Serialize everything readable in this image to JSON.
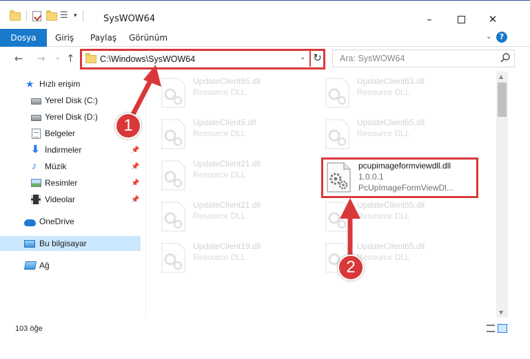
{
  "window": {
    "title": "SysWOW64",
    "icons": [
      "folder-icon",
      "properties-icon",
      "new-folder-icon"
    ],
    "controls": {
      "minimize": "–",
      "close": "✕"
    }
  },
  "ribbon": {
    "tabs": [
      {
        "label": "Dosya",
        "active": true
      },
      {
        "label": "Giriş",
        "active": false
      },
      {
        "label": "Paylaş",
        "active": false
      },
      {
        "label": "Görünüm",
        "active": false
      }
    ],
    "help": "?"
  },
  "navigation": {
    "back": "←",
    "forward": "→",
    "up": "↑",
    "address": "C:\\Windows\\SysWOW64",
    "refresh": "↻",
    "search_placeholder": "Ara: SysWOW64"
  },
  "sidebar": {
    "items": [
      {
        "label": "Hızlı erişim",
        "icon": "star-icon"
      },
      {
        "label": "Yerel Disk (C:)",
        "icon": "drive-icon"
      },
      {
        "label": "Yerel Disk (D:)",
        "icon": "drive-icon"
      },
      {
        "label": "Belgeler",
        "icon": "documents-icon"
      },
      {
        "label": "İndirmeler",
        "icon": "downloads-icon",
        "pinned": true
      },
      {
        "label": "Müzik",
        "icon": "music-icon",
        "pinned": true
      },
      {
        "label": "Resimler",
        "icon": "pictures-icon",
        "pinned": true
      },
      {
        "label": "Videolar",
        "icon": "videos-icon",
        "pinned": true
      },
      {
        "label": "OneDrive",
        "icon": "onedrive-icon"
      },
      {
        "label": "Bu bilgisayar",
        "icon": "this-pc-icon",
        "selected": true
      },
      {
        "label": "Ağ",
        "icon": "network-icon"
      }
    ],
    "pin_glyph": "📌"
  },
  "files": {
    "left_column": [
      {
        "name": "UpdateClient65.dll",
        "desc": "Resource DLL"
      },
      {
        "name": "UpdateClient5.dll",
        "desc": "Resource DLL"
      },
      {
        "name": "UpdateClient21.dll",
        "desc": "Resource DLL"
      },
      {
        "name": "UpdateClient21.dll",
        "desc": "Resource DLL"
      },
      {
        "name": "UpdateClient19.dll",
        "desc": "Resource DLL"
      }
    ],
    "right_column": [
      {
        "name": "UpdateClient63.dll",
        "desc": "Resource DLL"
      },
      {
        "name": "UpdateClient65.dll",
        "desc": "Resource DLL"
      },
      {
        "name": "UpdateClient65.dll",
        "desc": "Resource DLL"
      },
      {
        "name": "UpdateClient65.dll",
        "desc": "Resource DLL"
      }
    ],
    "highlighted": {
      "name": "pcupimageformviewdll.dll",
      "version": "1.0.0.1",
      "desc": "PcUpImageFormViewDl..."
    }
  },
  "status": {
    "item_count": "103 öğe"
  },
  "annotations": {
    "step1": "1",
    "step2": "2",
    "color": "#d9383a"
  }
}
